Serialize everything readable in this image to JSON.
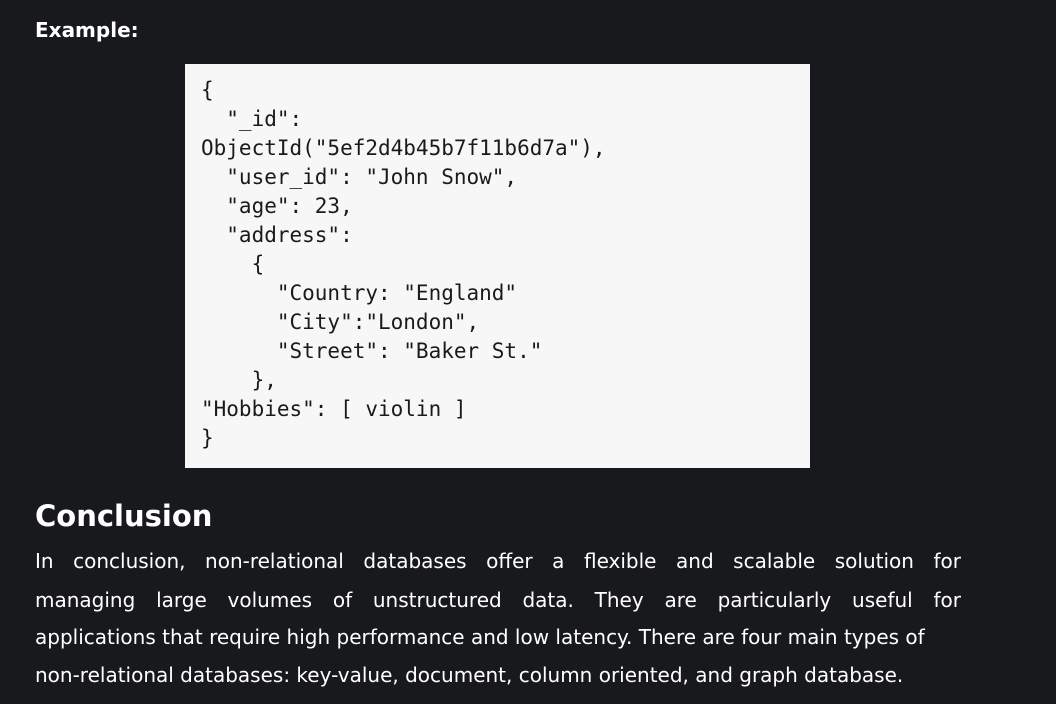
{
  "example": {
    "label": "Example:"
  },
  "code_block": {
    "lines": [
      "{",
      "  \"_id\":",
      "ObjectId(\"5ef2d4b45b7f11b6d7a\"),",
      "  \"user_id\": \"John Snow\",",
      "  \"age\": 23,",
      "  \"address\":",
      "    {",
      "      \"Country: \"England\"",
      "      \"City\":\"London\",",
      "      \"Street\": \"Baker St.\"",
      "    },",
      "\"Hobbies\": [ violin ]",
      "}"
    ]
  },
  "conclusion": {
    "heading": "Conclusion",
    "lines": [
      "In conclusion,  non-relational databases offer a flexible and scalable solution for",
      "managing large volumes of unstructured data. They are particularly useful for",
      "applications that require high performance and low latency. There are four main types of",
      "non-relational databases: key-value, document, column oriented, and graph database."
    ]
  }
}
